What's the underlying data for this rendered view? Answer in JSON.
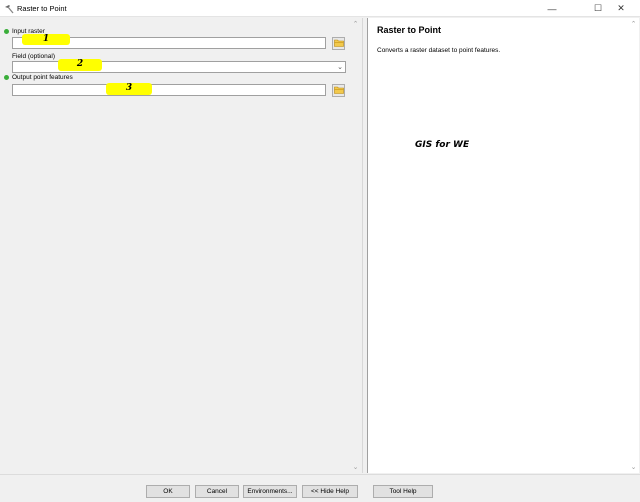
{
  "window": {
    "title": "Raster to Point",
    "minimize_glyph": "—",
    "maximize_glyph": "☐",
    "close_glyph": "✕"
  },
  "params": [
    {
      "label": "Input raster",
      "required": true,
      "value": "",
      "marker": "1"
    },
    {
      "label": "Field (optional)",
      "required": false,
      "value": "",
      "marker": "2"
    },
    {
      "label": "Output point features",
      "required": true,
      "value": "",
      "marker": "3"
    }
  ],
  "help": {
    "title": "Raster to Point",
    "text": "Converts a raster dataset to point features.",
    "watermark": "GIS for WE"
  },
  "buttons": {
    "ok": "OK",
    "cancel": "Cancel",
    "environments": "Environments...",
    "hide_help": "<< Hide Help",
    "tool_help": "Tool Help"
  },
  "colors": {
    "required_dot": "#3aae3a",
    "highlight": "#ffff00"
  }
}
